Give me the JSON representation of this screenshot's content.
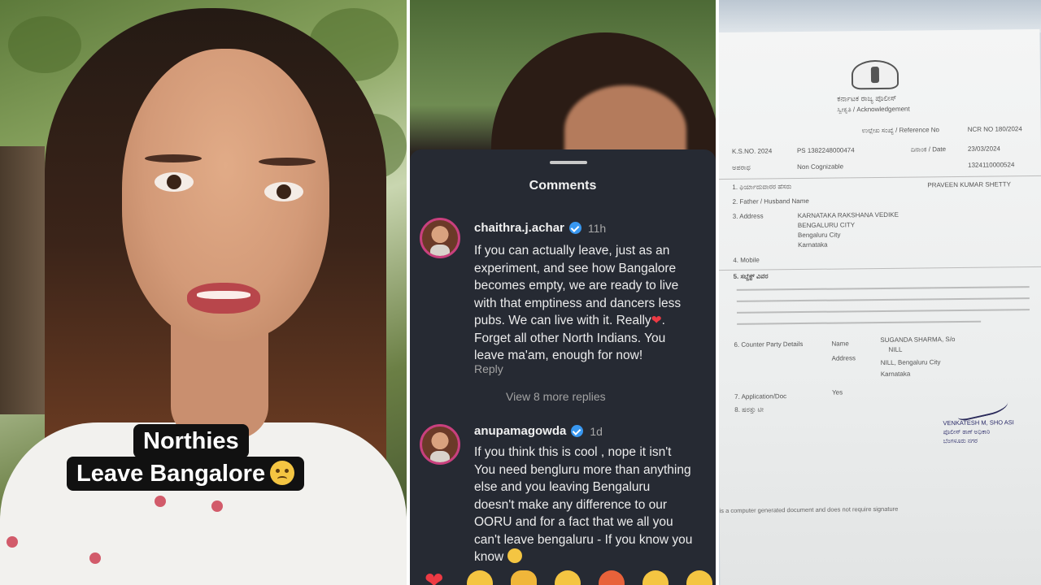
{
  "caption": {
    "line1": "Northies",
    "line2": "Leave Bangalore",
    "emoji": "crying-face-icon"
  },
  "comments_panel": {
    "title": "Comments",
    "comments": [
      {
        "user": "chaithra.j.achar",
        "time": "11h",
        "text_lines": [
          "If you can actually leave, just as an",
          "experiment, and see how Bangalore",
          "becomes empty, we are ready to live",
          "with that emptiness and dancers less",
          "pubs. We can live with it. Really"
        ],
        "text_tail": "Forget all other North Indians. You",
        "text_tail2": "leave ma'am, enough for now!",
        "reply_label": "Reply",
        "view_more": "View 8 more replies"
      },
      {
        "user": "anupamagowda",
        "time": "1d",
        "text_lines": [
          "If you think this is cool , nope it isn't",
          "You need bengluru more than anything",
          "else and you leaving Bengaluru",
          "doesn't make any difference to our",
          "OORU and for a fact that we all you",
          "can't leave bengaluru - If you know you"
        ],
        "text_tail": "know"
      }
    ],
    "reactions": [
      "heart-icon",
      "raised-hands-icon",
      "fire-icon",
      "rolling-laugh-icon",
      "angry-face-icon",
      "grin-icon",
      "sad-face-icon"
    ]
  },
  "document": {
    "header_kn": "ಕರ್ನಾಟಕ ರಾಜ್ಯ ಪೊಲೀಸ್",
    "header_sub": "ಸ್ವೀಕೃತಿ / Acknowledgement",
    "ref_label": "ಉಲ್ಲೇಖ ಸಂಖ್ಯೆ / Reference No",
    "ref_value": "NCR NO 180/2024",
    "ps_label": "K.S.NO. 2024",
    "ps_value": "PS 1382248000474",
    "date_label": "ದಿನಾಂಕ / Date",
    "date_value": "23/03/2024",
    "act_label": "ಅಪರಾಧ",
    "act_value": "Non Cognizable",
    "id_value": "1324110000524",
    "complainant_label": "1. ಫಿರ್ಯಾದುದಾರರ ಹೆಸರು",
    "complainant_value": "PRAVEEN KUMAR SHETTY",
    "father_label": "2. Father / Husband Name",
    "address_label": "3. Address",
    "address_lines": [
      "KARNATAKA RAKSHANA VEDIKE",
      "BENGALURU CITY",
      "Bengaluru City",
      "Karnataka"
    ],
    "mobile_label": "4. Mobile",
    "subject_label": "5. ಸಬ್ಜೆಕ್ಟ್ ವಿವರ",
    "counter_label": "6. Counter Party Details",
    "counter_name_label": "Name",
    "counter_name": "SUGANDA SHARMA, S/o",
    "counter_null": "NILL",
    "counter_address_label": "Address",
    "counter_address": "NILL, Bengaluru City",
    "counter_state": "Karnataka",
    "application_label": "7. Application/Doc",
    "application_value": "Yes",
    "remarks_label": "8. ಷರತ್ತು ಟೀ",
    "officer": "VENKATESH M, SHO ASI",
    "officer_kn1": "ಪೊಲೀಸ್ ಠಾಣೆ ಅಧಿಕಾರಿ",
    "officer_kn2": "ಬೆಂಗಳೂರು ನಗರ",
    "footer": "is a computer generated document and does not require signature"
  }
}
